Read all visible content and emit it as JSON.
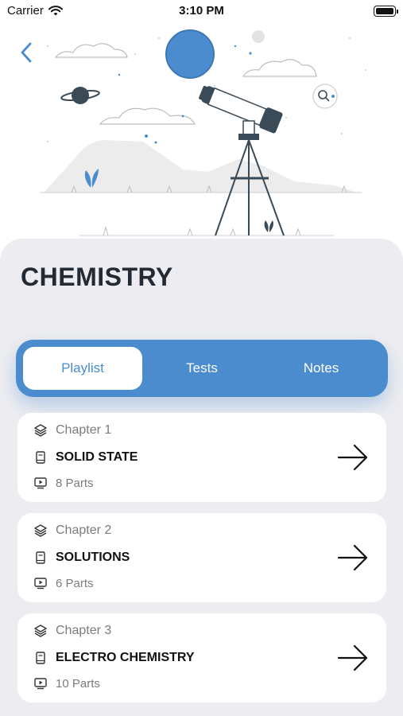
{
  "status_bar": {
    "carrier": "Carrier",
    "time": "3:10 PM"
  },
  "page": {
    "title": "CHEMISTRY"
  },
  "tabs": [
    {
      "label": "Playlist",
      "active": true
    },
    {
      "label": "Tests",
      "active": false
    },
    {
      "label": "Notes",
      "active": false
    }
  ],
  "chapters": [
    {
      "chapter": "Chapter 1",
      "title": "SOLID STATE",
      "parts": "8 Parts"
    },
    {
      "chapter": "Chapter 2",
      "title": "SOLUTIONS",
      "parts": "6 Parts"
    },
    {
      "chapter": "Chapter 3",
      "title": "ELECTRO CHEMISTRY",
      "parts": "10 Parts"
    }
  ],
  "icons": {
    "back": "chevron-left-icon",
    "wifi": "wifi-icon",
    "battery": "battery-icon",
    "chapter": "layers-icon",
    "title": "book-icon",
    "parts": "video-icon",
    "open": "arrow-right-icon"
  },
  "colors": {
    "accent": "#4a8ccd",
    "sheet": "#ededf1",
    "card": "#ffffff"
  }
}
